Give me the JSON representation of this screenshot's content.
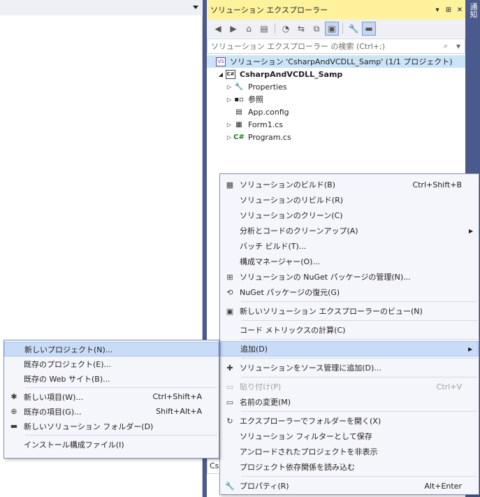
{
  "solution_explorer": {
    "title": "ソリューション エクスプローラー",
    "pin_icon": "▾",
    "pin2_icon": "⊞",
    "close_icon": "✕",
    "search_placeholder": "ソリューション エクスプローラー の検索 (Ctrl+;)",
    "tree": {
      "solution": "ソリューション 'CsharpAndVCDLL_Samp' (1/1 プロジェクト)",
      "project": "CsharpAndVCDLL_Samp",
      "project_badge": "C#",
      "children": [
        {
          "label": "Properties",
          "icon": "wrench-icon",
          "glyph": "🔧",
          "expandable": true
        },
        {
          "label": "参照",
          "icon": "references-icon",
          "glyph": "▪▫",
          "expandable": true
        },
        {
          "label": "App.config",
          "icon": "config-file-icon",
          "glyph": "▤",
          "expandable": false
        },
        {
          "label": "Form1.cs",
          "icon": "form-icon",
          "glyph": "▦",
          "expandable": true
        },
        {
          "label": "Program.cs",
          "icon": "csharp-file-icon",
          "glyph": "C#",
          "expandable": true
        }
      ]
    },
    "bottom_tab": "Cs"
  },
  "notifications_label": "通知",
  "context_menu": {
    "items": [
      {
        "icon": "▦",
        "label": "ソリューションのビルド(B)",
        "shortcut": "Ctrl+Shift+B"
      },
      {
        "icon": "",
        "label": "ソリューションのリビルド(R)",
        "shortcut": ""
      },
      {
        "icon": "",
        "label": "ソリューションのクリーン(C)",
        "shortcut": ""
      },
      {
        "icon": "",
        "label": "分析とコードのクリーンアップ(A)",
        "shortcut": "",
        "submenu": true
      },
      {
        "icon": "",
        "label": "バッチ ビルド(T)...",
        "shortcut": ""
      },
      {
        "icon": "",
        "label": "構成マネージャー(O)...",
        "shortcut": ""
      },
      {
        "icon": "⊞",
        "label": "ソリューションの NuGet パッケージの管理(N)...",
        "shortcut": ""
      },
      {
        "icon": "⟲",
        "label": "NuGet パッケージの復元(G)",
        "shortcut": ""
      },
      {
        "sep": true
      },
      {
        "icon": "▣",
        "label": "新しいソリューション エクスプローラーのビュー(N)",
        "shortcut": ""
      },
      {
        "sep": true
      },
      {
        "icon": "",
        "label": "コード メトリックスの計算(C)",
        "shortcut": ""
      },
      {
        "sep": true
      },
      {
        "icon": "",
        "label": "追加(D)",
        "shortcut": "",
        "submenu": true,
        "highlighted": true
      },
      {
        "sep": true
      },
      {
        "icon": "✚",
        "label": "ソリューションをソース管理に追加(D)...",
        "shortcut": ""
      },
      {
        "sep": true
      },
      {
        "icon": "▭",
        "label": "貼り付け(P)",
        "shortcut": "Ctrl+V",
        "disabled": true
      },
      {
        "icon": "▭",
        "label": "名前の変更(M)",
        "shortcut": ""
      },
      {
        "sep": true
      },
      {
        "icon": "↻",
        "label": "エクスプローラーでフォルダーを開く(X)",
        "shortcut": ""
      },
      {
        "icon": "",
        "label": "ソリューション フィルターとして保存",
        "shortcut": ""
      },
      {
        "icon": "",
        "label": "アンロードされたプロジェクトを非表示",
        "shortcut": ""
      },
      {
        "icon": "",
        "label": "プロジェクト依存関係を読み込む",
        "shortcut": ""
      },
      {
        "sep": true
      },
      {
        "icon": "🔧",
        "label": "プロパティ(R)",
        "shortcut": "Alt+Enter"
      }
    ]
  },
  "add_submenu": {
    "items": [
      {
        "icon": "",
        "label": "新しいプロジェクト(N)...",
        "shortcut": "",
        "highlighted": true
      },
      {
        "icon": "",
        "label": "既存のプロジェクト(E)...",
        "shortcut": ""
      },
      {
        "icon": "",
        "label": "既存の Web サイト(B)...",
        "shortcut": ""
      },
      {
        "sep": true
      },
      {
        "icon": "✱",
        "label": "新しい項目(W)...",
        "shortcut": "Ctrl+Shift+A"
      },
      {
        "icon": "⊕",
        "label": "既存の項目(G)...",
        "shortcut": "Shift+Alt+A"
      },
      {
        "icon": "▬",
        "label": "新しいソリューション フォルダー(D)",
        "shortcut": ""
      },
      {
        "sep": true
      },
      {
        "icon": "",
        "label": "インストール構成ファイル(I)",
        "shortcut": ""
      }
    ]
  },
  "colors": {
    "title_bar": "#fff29d",
    "highlight": "#c9dcf7",
    "frame": "#4a5a8c"
  }
}
